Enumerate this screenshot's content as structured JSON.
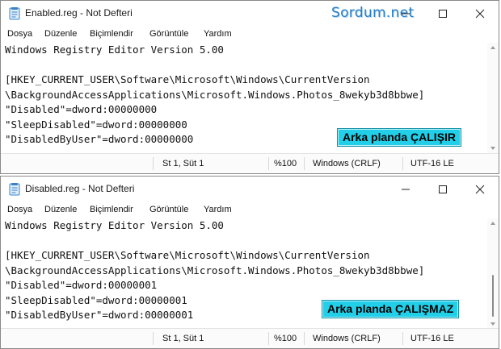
{
  "watermark": "Sordum.net",
  "menu": [
    "Dosya",
    "Düzenle",
    "Biçimlendir",
    "Görüntüle",
    "Yardım"
  ],
  "colors": {
    "badge_bg": "#22cfe8",
    "watermark": "#2c7fc4"
  },
  "window1": {
    "title": "Enabled.reg - Not Defteri",
    "lines": [
      "Windows Registry Editor Version 5.00",
      "",
      "[HKEY_CURRENT_USER\\Software\\Microsoft\\Windows\\CurrentVersion",
      "\\BackgroundAccessApplications\\Microsoft.Windows.Photos_8wekyb3d8bbwe]",
      "\"Disabled\"=dword:00000000",
      "\"SleepDisabled\"=dword:00000000",
      "\"DisabledByUser\"=dword:00000000"
    ],
    "badge": "Arka planda ÇALIŞIR",
    "status": {
      "position": "St 1, Süt 1",
      "zoom": "%100",
      "line_ending": "Windows (CRLF)",
      "encoding": "UTF-16 LE"
    }
  },
  "window2": {
    "title": "Disabled.reg - Not Defteri",
    "lines": [
      "Windows Registry Editor Version 5.00",
      "",
      "[HKEY_CURRENT_USER\\Software\\Microsoft\\Windows\\CurrentVersion",
      "\\BackgroundAccessApplications\\Microsoft.Windows.Photos_8wekyb3d8bbwe]",
      "\"Disabled\"=dword:00000001",
      "\"SleepDisabled\"=dword:00000001",
      "\"DisabledByUser\"=dword:00000001"
    ],
    "badge": "Arka planda ÇALIŞMAZ",
    "status": {
      "position": "St 1, Süt 1",
      "zoom": "%100",
      "line_ending": "Windows (CRLF)",
      "encoding": "UTF-16 LE"
    }
  }
}
